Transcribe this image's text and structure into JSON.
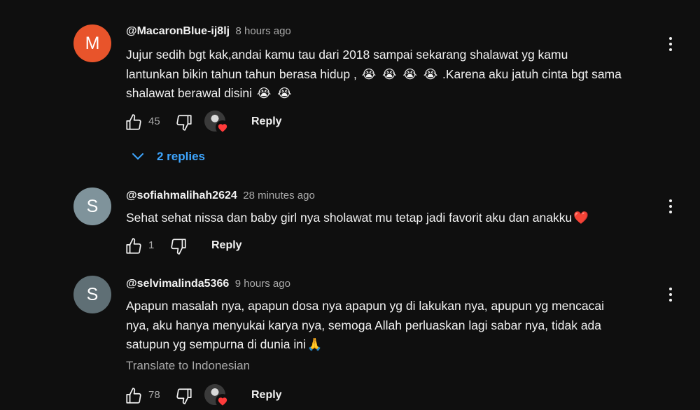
{
  "colors": {
    "background": "#0f0f0f",
    "link_blue": "#3ea6ff",
    "secondary_text": "#aaaaaa"
  },
  "comments": [
    {
      "avatar_letter": "M",
      "avatar_color": "#e8542b",
      "author": "@MacaronBlue-ij8lj",
      "time": "8 hours ago",
      "text_lines": [
        "Jujur sedih bgt kak,andai kamu tau dari 2018 sampai sekarang shalawat yg kamu",
        "lantunkan bikin tahun tahun berasa hidup ,",
        " .Karena aku jatuh cinta bgt sama",
        "shalawat berawal disini "
      ],
      "emoji": "😭",
      "likes": "45",
      "reply_label": "Reply",
      "replies_label": "2 replies",
      "creator_heart": true
    },
    {
      "avatar_letter": "S",
      "avatar_color": "#7f939b",
      "author": "@sofiahmalihah2624",
      "time": "28 minutes ago",
      "text": "Sehat sehat nissa dan baby girl nya sholawat mu tetap jadi favorit aku dan anakku",
      "text_emoji": "❤️",
      "likes": "1",
      "reply_label": "Reply",
      "creator_heart": false
    },
    {
      "avatar_letter": "S",
      "avatar_color": "#5f6f75",
      "author": "@selvimalinda5366",
      "time": "9 hours ago",
      "text_lines": [
        "Apapun masalah nya, apapun dosa nya apapun yg di lakukan nya, apupun yg mencacai",
        "nya, aku hanya menyukai karya nya, semoga Allah perluaskan lagi sabar nya, tidak ada",
        "satupun yg sempurna di dunia ini"
      ],
      "text_emoji": "🙏",
      "translate_label": "Translate to Indonesian",
      "likes": "78",
      "reply_label": "Reply",
      "creator_heart": true
    }
  ],
  "icons": {
    "like": "thumbs-up-icon",
    "dislike": "thumbs-down-icon",
    "more": "more-vertical-icon",
    "expand": "chevron-down-icon",
    "heart": "heart-icon"
  }
}
